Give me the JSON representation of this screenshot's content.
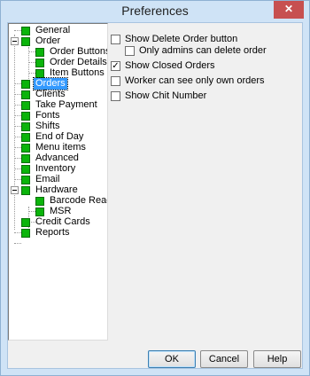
{
  "window": {
    "title": "Preferences",
    "close_glyph": "✕"
  },
  "tree": {
    "items": [
      {
        "label": "General"
      },
      {
        "label": "Order"
      },
      {
        "label": "Order Buttons"
      },
      {
        "label": "Order Details"
      },
      {
        "label": "Item Buttons"
      },
      {
        "label": "Orders",
        "selected": true
      },
      {
        "label": "Clients"
      },
      {
        "label": "Take Payment"
      },
      {
        "label": "Fonts"
      },
      {
        "label": "Shifts"
      },
      {
        "label": "End of Day"
      },
      {
        "label": "Menu items"
      },
      {
        "label": "Advanced"
      },
      {
        "label": "Inventory"
      },
      {
        "label": "Email"
      },
      {
        "label": "Hardware"
      },
      {
        "label": "Barcode Reader"
      },
      {
        "label": "MSR"
      },
      {
        "label": "Credit Cards"
      },
      {
        "label": "Reports"
      }
    ],
    "node_color": "#0bb40b",
    "selected_color": "#3399ff"
  },
  "options": [
    {
      "label": "Show Delete Order button",
      "checked": false
    },
    {
      "label": "Only admins can delete order",
      "checked": false
    },
    {
      "label": "Show Closed Orders",
      "checked": true
    },
    {
      "label": "Worker can see only own orders",
      "checked": false
    },
    {
      "label": "Show Chit Number",
      "checked": false
    }
  ],
  "buttons": {
    "ok": "OK",
    "cancel": "Cancel",
    "help": "Help"
  }
}
